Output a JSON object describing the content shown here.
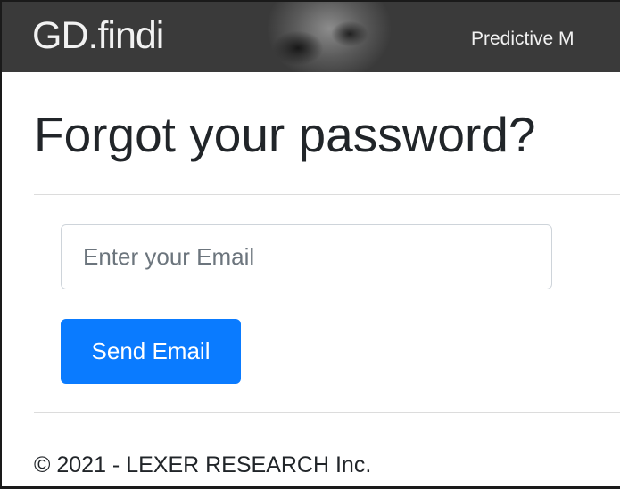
{
  "navbar": {
    "brand": "GD.findi",
    "nav_link": "Predictive M"
  },
  "main": {
    "title": "Forgot your password?",
    "email_input": {
      "value": "",
      "placeholder": "Enter your Email"
    },
    "send_button_label": "Send Email"
  },
  "footer": {
    "copyright": "© 2021 - LEXER RESEARCH Inc."
  },
  "colors": {
    "navbar_bg": "#3a3a3a",
    "primary_button": "#0a7bff",
    "text": "#212529"
  }
}
